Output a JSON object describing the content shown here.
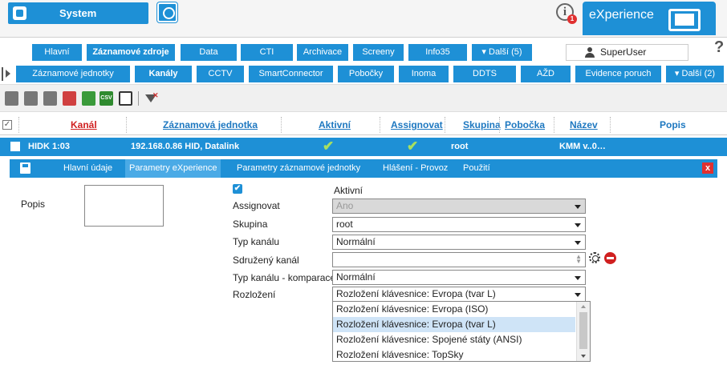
{
  "header": {
    "system_label": "System",
    "brand": "eXperience",
    "info_badge": "1"
  },
  "nav1": {
    "items": [
      {
        "label": "Hlavní"
      },
      {
        "label": "Záznamové zdroje"
      },
      {
        "label": "Data"
      },
      {
        "label": "CTI"
      },
      {
        "label": "Archivace"
      },
      {
        "label": "Screeny"
      },
      {
        "label": "Info35"
      },
      {
        "label": "▾ Další (5)"
      }
    ],
    "user": "SuperUser",
    "help": "?"
  },
  "nav2": {
    "items": [
      {
        "label": "Záznamové jednotky"
      },
      {
        "label": "Kanály"
      },
      {
        "label": "CCTV"
      },
      {
        "label": "SmartConnector"
      },
      {
        "label": "Pobočky"
      },
      {
        "label": "Inoma"
      },
      {
        "label": "DDTS"
      },
      {
        "label": "AŽD"
      },
      {
        "label": "Evidence poruch"
      },
      {
        "label": "▾ Další (2)"
      }
    ]
  },
  "toolbar": {
    "csv_label": "CSV",
    "icons": [
      "add-icon",
      "copy-icon",
      "settings-icon",
      "delete-icon",
      "export-icon",
      "csv-export-icon",
      "exit-icon",
      "clear-filter-icon"
    ]
  },
  "grid": {
    "columns": {
      "kanal": "Kanál",
      "zaznamova_jednotka": "Záznamová jednotka",
      "aktivni": "Aktivní",
      "assignovat": "Assignovat",
      "skupina": "Skupina",
      "pobocka": "Pobočka",
      "nazev": "Název",
      "popis": "Popis"
    },
    "row": {
      "kanal": "HIDK 1:03",
      "zaznamova_jednotka": "192.168.0.86 HID, Datalink",
      "aktivni": "✔",
      "assignovat": "✔",
      "skupina": "root",
      "nazev": "KMM v..0…"
    }
  },
  "detail": {
    "tabs": [
      {
        "label": "Hlavní údaje"
      },
      {
        "label": "Parametry eXperience"
      },
      {
        "label": "Parametry záznamové jednotky"
      },
      {
        "label": "Hlášení - Provoz"
      },
      {
        "label": "Použití"
      }
    ],
    "close": "x"
  },
  "form": {
    "popis_label": "Popis",
    "aktivni_label": "Aktivní",
    "aktivni_checked": "✔",
    "assignovat_label": "Assignovat",
    "assignovat_value": "Ano",
    "skupina_label": "Skupina",
    "skupina_value": "root",
    "typ_kanalu_label": "Typ kanálu",
    "typ_kanalu_value": "Normální",
    "sdruzeny_kanal_label": "Sdružený kanál",
    "sdruzeny_kanal_value": "",
    "typ_kanalu_komparace_label": "Typ kanálu - komparace",
    "typ_kanalu_komparace_value": "Normální",
    "rozlozeni_label": "Rozložení",
    "rozlozeni_value": "Rozložení klávesnice: Evropa (tvar L)",
    "rozlozeni_options": [
      "Rozložení klávesnice: Evropa (ISO)",
      "Rozložení klávesnice: Evropa (tvar L)",
      "Rozložení klávesnice: Spojené státy (ANSI)",
      "Rozložení klávesnice: TopSky"
    ]
  },
  "colors": {
    "accent": "#1e90d6",
    "close": "#e03030",
    "check": "#a8e060"
  }
}
